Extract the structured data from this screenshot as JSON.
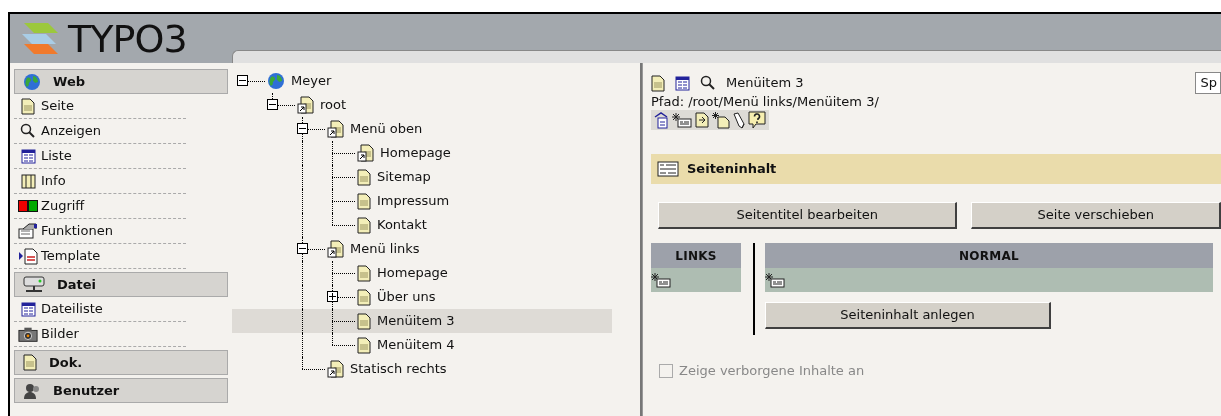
{
  "logo": {
    "text": "TYPO3"
  },
  "modules": [
    {
      "label": "Web",
      "items": [
        {
          "label": "Seite"
        },
        {
          "label": "Anzeigen"
        },
        {
          "label": "Liste"
        },
        {
          "label": "Info"
        },
        {
          "label": "Zugriff"
        },
        {
          "label": "Funktionen"
        },
        {
          "label": "Template"
        }
      ]
    },
    {
      "label": "Datei",
      "items": [
        {
          "label": "Dateiliste"
        },
        {
          "label": "Bilder"
        }
      ]
    },
    {
      "label": "Dok."
    },
    {
      "label": "Benutzer"
    }
  ],
  "tree": [
    {
      "label": "Meyer",
      "kind": "globe",
      "expanded": true,
      "selected": false,
      "children": [
        {
          "label": "root",
          "kind": "shortcut",
          "expanded": true,
          "selected": false,
          "children": [
            {
              "label": "Menü oben",
              "kind": "shortcut",
              "expanded": true,
              "selected": false,
              "children": [
                {
                  "label": "Homepage",
                  "kind": "shortcut",
                  "selected": false
                },
                {
                  "label": "Sitemap",
                  "kind": "page",
                  "selected": false
                },
                {
                  "label": "Impressum",
                  "kind": "page",
                  "selected": false
                },
                {
                  "label": "Kontakt",
                  "kind": "page",
                  "selected": false
                }
              ]
            },
            {
              "label": "Menü links",
              "kind": "shortcut",
              "expanded": true,
              "selected": false,
              "children": [
                {
                  "label": "Homepage",
                  "kind": "page",
                  "selected": false
                },
                {
                  "label": "Über uns",
                  "kind": "page",
                  "expanded": false,
                  "selected": false
                },
                {
                  "label": "Menüitem 3",
                  "kind": "page",
                  "selected": true
                },
                {
                  "label": "Menüitem 4",
                  "kind": "page",
                  "selected": false
                }
              ]
            },
            {
              "label": "Statisch rechts",
              "kind": "shortcut",
              "selected": false
            }
          ]
        }
      ]
    }
  ],
  "content": {
    "title": "Menüitem 3",
    "language_select": "Sp",
    "path": "Pfad: /root/Menü links/Menüitem 3/",
    "section": "Seiteninhalt",
    "buttons": [
      "Seitentitel bearbeiten",
      "Seite verschieben"
    ],
    "columns": [
      {
        "label": "LINKS"
      },
      {
        "label": "NORMAL",
        "button": "Seiteninhalt anlegen"
      }
    ],
    "show_hidden": {
      "label": "Zeige verborgene Inhalte an",
      "checked": false,
      "disabled": true
    }
  }
}
